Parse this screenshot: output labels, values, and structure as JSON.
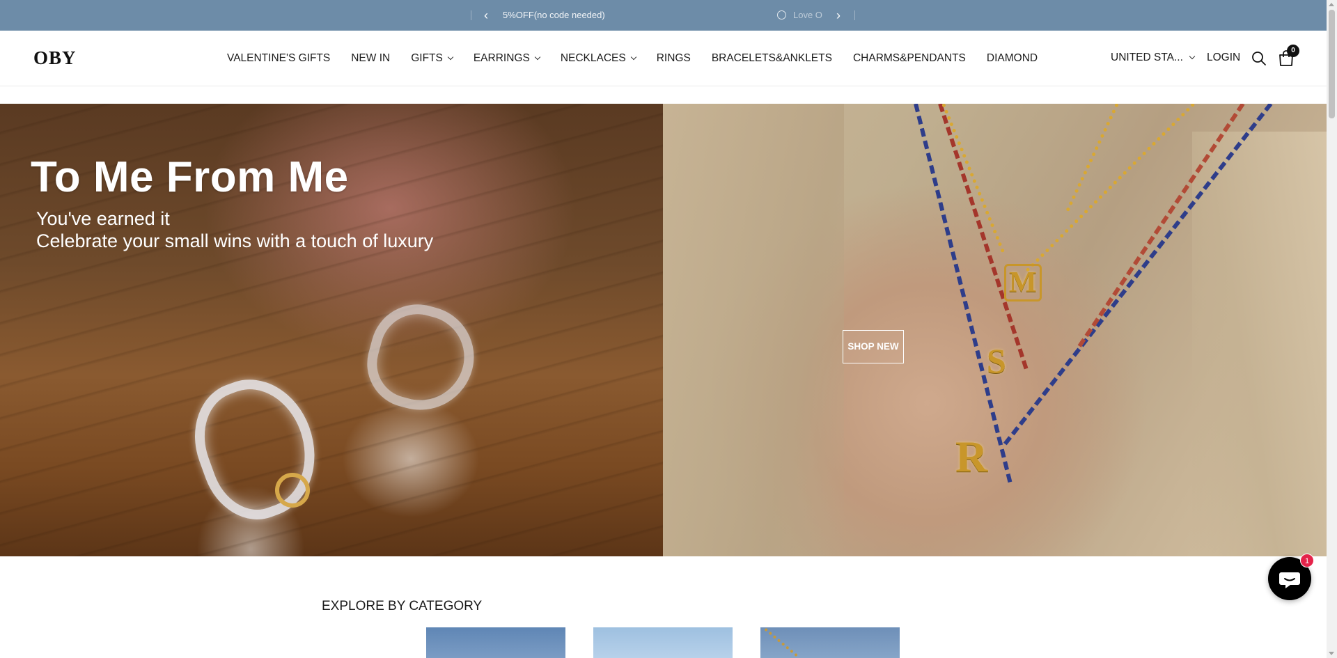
{
  "announcement": {
    "message_left": "5%OFF(no code needed)",
    "message_right": "Love O",
    "prev_icon": "chevron-left-icon",
    "next_icon": "chevron-right-icon",
    "bg_color": "#6d8ca8"
  },
  "header": {
    "logo": "OBY",
    "nav": [
      {
        "label": "VALENTINE'S GIFTS",
        "has_dropdown": false
      },
      {
        "label": "NEW IN",
        "has_dropdown": false
      },
      {
        "label": "GIFTS",
        "has_dropdown": true
      },
      {
        "label": "EARRINGS",
        "has_dropdown": true
      },
      {
        "label": "NECKLACES",
        "has_dropdown": true
      },
      {
        "label": "RINGS",
        "has_dropdown": false
      },
      {
        "label": "BRACELETS&ANKLETS",
        "has_dropdown": false
      },
      {
        "label": "CHARMS&PENDANTS",
        "has_dropdown": false
      },
      {
        "label": "DIAMOND",
        "has_dropdown": false
      }
    ],
    "country": "UNITED STA...",
    "login": "LOGIN",
    "cart_count": "0"
  },
  "hero": {
    "title": "To Me From Me",
    "subtitle_line1": "You've earned it",
    "subtitle_line2": "Celebrate your small wins with a touch of luxury",
    "button": "SHOP NEW",
    "pendants": [
      "M",
      "S",
      "R"
    ]
  },
  "explore": {
    "title": "EXPLORE BY CATEGORY"
  },
  "chat": {
    "badge": "1"
  }
}
